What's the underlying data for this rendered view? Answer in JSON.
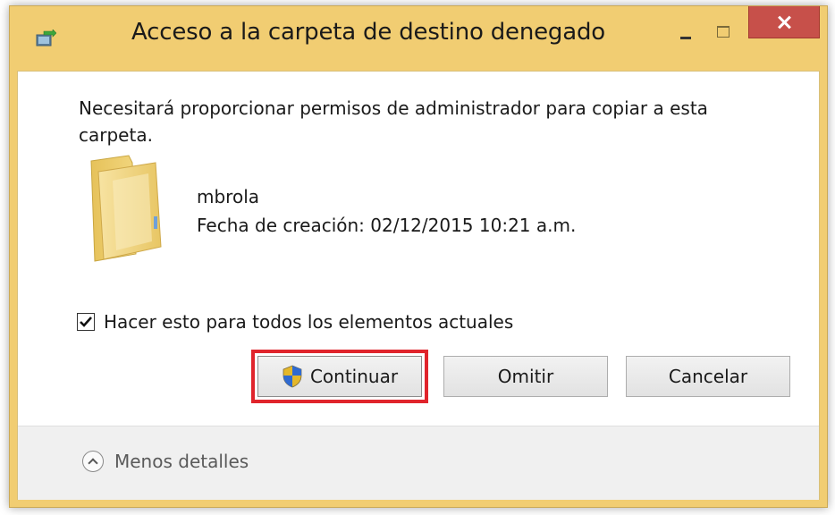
{
  "window": {
    "title": "Acceso a la carpeta de destino denegado",
    "accent_color": "#f1cd72",
    "close_color": "#c7504a"
  },
  "dialog": {
    "message": "Necesitará proporcionar permisos de administrador para copiar a esta carpeta.",
    "item": {
      "name": "mbrola",
      "created": "Fecha de creación: 02/12/2015 10:21 a.m."
    },
    "apply_all": {
      "label": "Hacer esto para todos los elementos actuales",
      "checked": true
    },
    "buttons": {
      "continue_label": "Continuar",
      "omit_label": "Omitir",
      "cancel_label": "Cancelar"
    },
    "details_toggle_label": "Menos detalles"
  },
  "icons": {
    "app": "copy-transfer-icon",
    "folder": "folder-icon",
    "shield": "uac-shield-icon",
    "check": "checkmark-icon",
    "chevron": "chevron-up-icon"
  },
  "highlight": {
    "target": "continue-button",
    "color": "#e0242c"
  }
}
